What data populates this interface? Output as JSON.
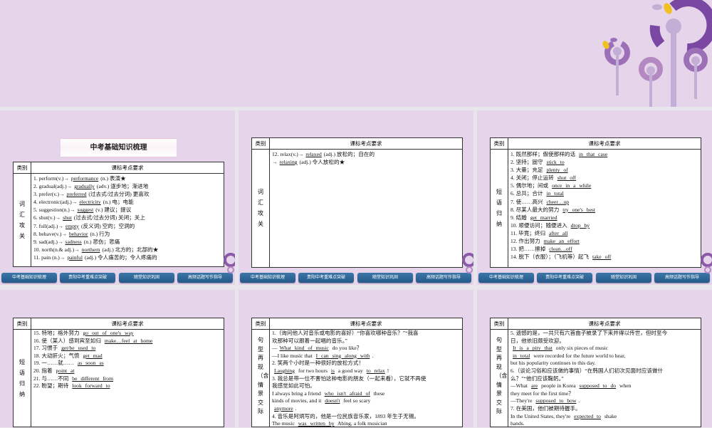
{
  "colors": {
    "background": "#e6d4ea",
    "nav_button": "#2f6a9a",
    "accent_purple": "#7b4a9e",
    "accent_yellow": "#f0c020"
  },
  "nav_labels": [
    "中考基础知识梳理",
    "贵阳中考重难点突破",
    "随堂知识巩固",
    "高频话题写作指导"
  ],
  "table_header": {
    "category": "类别",
    "requirement": "课标考点要求"
  },
  "slides": [
    {
      "banner": "中考基础知识梳理",
      "category": "词汇攻关",
      "lines": [
        [
          {
            "t": "1. perform(v.)→"
          },
          {
            "b": "performance"
          },
          {
            "t": "(n.) 表演★"
          }
        ],
        [
          {
            "t": "2. gradual(adj.)→"
          },
          {
            "b": "gradually"
          },
          {
            "t": "(adv.) 逐步地；渐进地"
          }
        ],
        [
          {
            "t": "3. prefer(v.)→"
          },
          {
            "b": "preferred"
          },
          {
            "t": "(过去式/过去分词) 更喜欢"
          }
        ],
        [
          {
            "t": "4. electronic(adj.)→"
          },
          {
            "b": "electricity"
          },
          {
            "t": "(n.) 电；电能"
          }
        ],
        [
          {
            "t": "5. suggestion(n.)→"
          },
          {
            "b": "suggest"
          },
          {
            "t": "(v.) 建议；提议"
          }
        ],
        [
          {
            "t": "6. shut(v.)→"
          },
          {
            "b": "shut"
          },
          {
            "t": "(过去式/过去分词) 关闭；关上"
          }
        ],
        [
          {
            "t": "7. full(adj.)→"
          },
          {
            "b": "empty"
          },
          {
            "t": "(反义词) 空的；空洞的"
          }
        ],
        [
          {
            "t": "8. behave(v.)→"
          },
          {
            "b": "behavior"
          },
          {
            "t": "(n.) 行为"
          }
        ],
        [
          {
            "t": "9. sad(adj.)→"
          },
          {
            "b": "sadness"
          },
          {
            "t": "(n.) 悲伤；悲痛"
          }
        ],
        [
          {
            "t": "10. north(n.& adj.)→"
          },
          {
            "b": "northern"
          },
          {
            "t": "(adj.) 北方的；北部的★"
          }
        ],
        [
          {
            "t": "11. pain (n.)→"
          },
          {
            "b": "painful"
          },
          {
            "t": "(adj.) 令人痛苦的；令人疼痛的"
          }
        ]
      ]
    },
    {
      "category": "词汇攻关",
      "lines": [
        [
          {
            "t": "12. relax(v.)→"
          },
          {
            "b": "relaxed"
          },
          {
            "t": "(adj.) 放松的；自在的"
          }
        ],
        [
          {
            "t": "→"
          },
          {
            "b": "relaxing"
          },
          {
            "t": "(adj.) 令人放松的★"
          }
        ]
      ]
    },
    {
      "category": "短语归纳",
      "lines": [
        [
          {
            "t": "1. 既然那样；假使那样的话 "
          },
          {
            "b": "in that case"
          }
        ],
        [
          {
            "t": "2. 坚持；固守 "
          },
          {
            "b": "stick to"
          }
        ],
        [
          {
            "t": "3. 大量；充足 "
          },
          {
            "b": "plenty of"
          }
        ],
        [
          {
            "t": "4. 关闭；停止运转 "
          },
          {
            "b": "shut off"
          }
        ],
        [
          {
            "t": "5. 偶尔地；间或 "
          },
          {
            "b": "once in a while"
          }
        ],
        [
          {
            "t": "6. 总共；合计 "
          },
          {
            "b": "in total"
          }
        ],
        [
          {
            "t": "7. 使……高兴 "
          },
          {
            "b": "cheer…up"
          }
        ],
        [
          {
            "t": "8. 尽某人最大的努力 "
          },
          {
            "b": "try one's best"
          }
        ],
        [
          {
            "t": "9. 结婚 "
          },
          {
            "b": "get married"
          }
        ],
        [
          {
            "t": "10. 顺便访问；随便进入 "
          },
          {
            "b": "drop by"
          }
        ],
        [
          {
            "t": "11. 毕竟；终归 "
          },
          {
            "b": "after all"
          }
        ],
        [
          {
            "t": "12. 作出努力 "
          },
          {
            "b": "make an effort"
          }
        ],
        [
          {
            "t": "13. 把……擦掉 "
          },
          {
            "b": "clean…off"
          }
        ],
        [
          {
            "t": "14. 脱下（衣服）；（飞机等）起飞 "
          },
          {
            "b": "take off"
          }
        ]
      ]
    },
    {
      "category": "短语归纳",
      "lines": [
        [
          {
            "t": "15. 特地；格外努力 "
          },
          {
            "b": "go out of one's way"
          }
        ],
        [
          {
            "t": "16. 使（某人）感到宾至如归 "
          },
          {
            "b": "make…feel at home"
          }
        ],
        [
          {
            "t": "17. 习惯于 "
          },
          {
            "b": "get/be used to"
          }
        ],
        [
          {
            "t": "18. 大动肝火；气愤 "
          },
          {
            "b": "get mad"
          }
        ],
        [
          {
            "t": "19. 一……就…… "
          },
          {
            "b": "as soon as"
          }
        ],
        [
          {
            "t": "20. 指着 "
          },
          {
            "b": "point at"
          }
        ],
        [
          {
            "t": "21. 与……不同 "
          },
          {
            "b": "be different from"
          }
        ],
        [
          {
            "t": "22. 盼望；期待 "
          },
          {
            "b": "look forward to"
          }
        ]
      ]
    },
    {
      "category": "句型再现（含情景交际",
      "lines": [
        [
          {
            "t": "1.（询问他人对音乐或电影的喜好）“你喜欢哪种音乐？”“我喜"
          }
        ],
        [
          {
            "t": "欢那种可以跟着一起唱的音乐。”"
          }
        ],
        [
          {
            "t": "—"
          },
          {
            "b": "What kind of music"
          },
          {
            "t": " do you like？"
          }
        ],
        [
          {
            "t": "—I like music that "
          },
          {
            "b": "I can sing along with"
          },
          {
            "t": "."
          }
        ],
        [
          {
            "t": "2. 笑两个小时是一种很好的放松方式！"
          }
        ],
        [
          {
            "b": "Laughing"
          },
          {
            "t": " for two hours "
          },
          {
            "b": "is"
          },
          {
            "t": " a good way "
          },
          {
            "b": "to relax"
          },
          {
            "t": "!"
          }
        ],
        [
          {
            "t": "3. 我总是带一位不害怕这种电影的朋友（一起来看），它就不再使"
          }
        ],
        [
          {
            "t": "我感觉如此可怕。"
          }
        ],
        [
          {
            "t": "I always bring a friend "
          },
          {
            "b": "who isn't afraid of"
          },
          {
            "t": " these"
          }
        ],
        [
          {
            "t": "kinds of movies, and it "
          },
          {
            "b": "doesn't"
          },
          {
            "t": " feel so scary"
          }
        ],
        [
          {
            "b": "anymore"
          },
          {
            "t": "."
          }
        ],
        [
          {
            "t": "4. 音乐是阿炳写的，他是一位民族音乐家，1893 年生于无锡。"
          }
        ],
        [
          {
            "t": "The music "
          },
          {
            "b": "was written by"
          },
          {
            "t": " Abing, a folk musician"
          }
        ]
      ]
    },
    {
      "category": "句型再现（含情景交际",
      "lines": [
        [
          {
            "t": "5. 遗憾的是，一共只有六首曲子被录了下来并得以传世，但时至今"
          }
        ],
        [
          {
            "t": "日，他依旧颇受欢迎。"
          }
        ],
        [
          {
            "b": "It is a pity that"
          },
          {
            "t": " only six pieces of music"
          }
        ],
        [
          {
            "b": "in total"
          },
          {
            "t": " were recorded for the future world to hear,"
          }
        ],
        [
          {
            "t": "but his popularity continues to this day."
          }
        ],
        [
          {
            "t": "6.（谈论习俗和应该做的事情）“在韩国人们初次见面时应该做什"
          }
        ],
        [
          {
            "t": "么？”“他们应该鞠躬。”"
          }
        ],
        [
          {
            "t": "—What "
          },
          {
            "b": "are"
          },
          {
            "t": " people in Korea "
          },
          {
            "b": "supposed to do"
          },
          {
            "t": " when"
          }
        ],
        [
          {
            "t": "they meet for the first time？"
          }
        ],
        [
          {
            "t": "—They're "
          },
          {
            "b": "supposed to bow"
          },
          {
            "t": "."
          }
        ],
        [
          {
            "t": "7. 在美国，他们被期待握手。"
          }
        ],
        [
          {
            "t": "In the United States, they're "
          },
          {
            "b": "expected to"
          },
          {
            "t": " shake"
          }
        ],
        [
          {
            "t": "hands."
          }
        ]
      ]
    }
  ]
}
